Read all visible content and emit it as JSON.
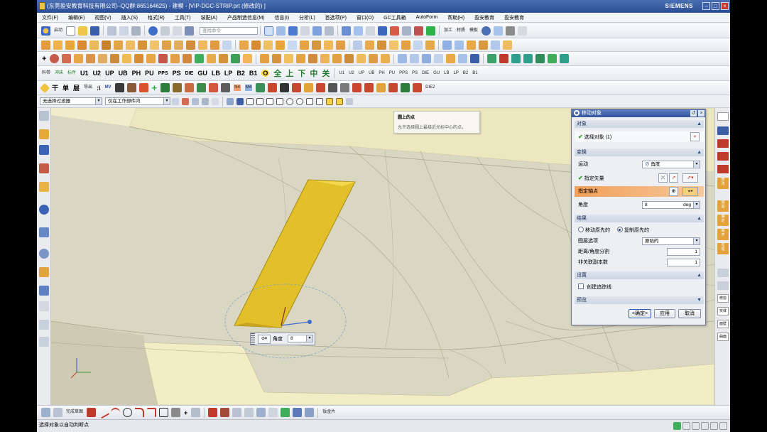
{
  "title_bar": {
    "title": "(东莞盈安教育科技有限公司--QQ群:865164625) - 建模 - [VIP-DGC-STRIP.prt (修改的) ]",
    "brand": "SIEMENS"
  },
  "menu": [
    "文件(F)",
    "编辑(E)",
    "视图(V)",
    "插入(S)",
    "格式(R)",
    "工具(T)",
    "装配(A)",
    "产品制造信息(M)",
    "信息(I)",
    "分析(L)",
    "首选项(P)",
    "窗口(O)",
    "GC工具箱",
    "AutoForm",
    "帮助(H)",
    "盈安教育",
    "盈安教育"
  ],
  "toolbar1": {
    "start_label": "启动",
    "search_placeholder": "查找命令",
    "right_labels": [
      "加工",
      "材质",
      "模板"
    ]
  },
  "toolbar3": {
    "items": [
      "料带",
      "冲床",
      "标件",
      "U1",
      "U2",
      "UP",
      "UB",
      "PH",
      "PU",
      "PPS",
      "PS",
      "DIE",
      "GU",
      "LB",
      "LP",
      "B2",
      "B1",
      "O",
      "全",
      "上",
      "下",
      "中",
      "关"
    ],
    "right_items": [
      "U1",
      "U2",
      "UP",
      "UB",
      "PH",
      "PU",
      "PPS",
      "PS",
      "DIE",
      "GU",
      "LB",
      "LP",
      "B2",
      "B1"
    ]
  },
  "toolbar4": {
    "items": [
      "干",
      "单",
      "层",
      "导出",
      ":\\",
      "MV",
      "N4",
      "M4",
      "DIE2"
    ]
  },
  "selection_bar": {
    "filter_value": "无选择过滤器",
    "scope_value": "仅在工作部件内"
  },
  "tooltip": {
    "title": "圆上的点",
    "description": "允许选择圆上最接近光标中心的点。"
  },
  "dialog": {
    "title": "移动对象",
    "sections": {
      "object": "对象",
      "transform": "变换",
      "result": "结果",
      "settings": "设置",
      "preview": "预览"
    },
    "select_object_label": "选择对象 (1)",
    "motion_label": "运动",
    "motion_value": "角度",
    "vector_label": "指定矢量",
    "pivot_label": "指定轴点",
    "angle_label": "角度",
    "angle_value": "8",
    "angle_unit": "deg",
    "move_original_label": "移动原先的",
    "copy_original_label": "复制原先的",
    "layer_label": "图层选项",
    "layer_value": "原始的",
    "distance_label": "距离/角度分割",
    "distance_value": "1",
    "copies_label": "非关联副本数",
    "copies_value": "1",
    "trace_label": "创建追踪线",
    "ok_label": "<确定>",
    "apply_label": "应用",
    "cancel_label": "取消"
  },
  "onscreen_input": {
    "label": "角度",
    "value": "8"
  },
  "bottom_toolbar": {
    "sketch_label": "完成草图",
    "sheet_label": "钣金片"
  },
  "right_bar_labels": [
    "修",
    "改",
    "侧",
    "退",
    "确",
    "定",
    "展",
    "开",
    "管",
    "理",
    "修剪",
    "实体",
    "面壁",
    "曲面"
  ],
  "status_bar": {
    "message": "选择对象以自动判断点"
  },
  "colors": {
    "title_bar": "#34559c",
    "viewport_bg": "#d9d6c0",
    "body_yellow": "#e3c02a",
    "highlight_orange": "#f0a05a",
    "check_green": "#2b9a2b"
  }
}
